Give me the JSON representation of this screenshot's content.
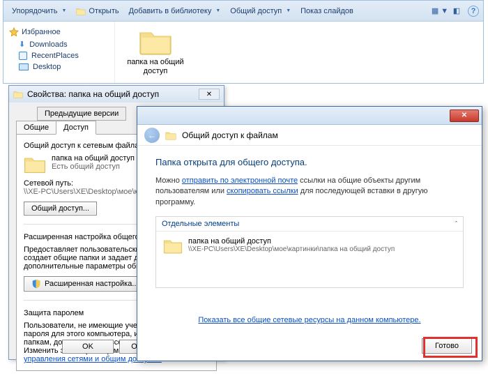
{
  "explorer": {
    "toolbar": {
      "organize": "Упорядочить",
      "open": "Открыть",
      "addlib": "Добавить в библиотеку",
      "share": "Общий доступ",
      "slideshow": "Показ слайдов"
    },
    "favorites": {
      "header": "Избранное",
      "items": [
        "Downloads",
        "RecentPlaces",
        "Desktop"
      ]
    },
    "folder_name": "папка на общий доступ"
  },
  "props": {
    "title": "Свойства: папка на общий доступ",
    "tabs": {
      "prev": "Предыдущие версии",
      "general": "Общие",
      "access": "Доступ"
    },
    "section1_title": "Общий доступ к сетевым файлам и папкам",
    "folder_name": "папка на общий доступ",
    "status": "Есть общий доступ",
    "netpath_label": "Сетевой путь:",
    "netpath": "\\\\XE-PC\\Users\\XE\\Desktop\\мое\\картинки",
    "btn_share": "Общий доступ...",
    "adv_title": "Расширенная настройка общего доступа",
    "adv_text": "Предоставляет пользовательские разрешения, создает общие папки и задает другие дополнительные параметры общего доступа.",
    "btn_adv": "Расширенная настройка...",
    "pwd_title": "Защита паролем",
    "pwd_text": "Пользователи, не имеющие учетной записи и пароля для этого компьютера, имеют доступ к папкам, доступным для всех.",
    "pwd_link_pre": "Изменить этот параметр можно через ",
    "pwd_link": "Центр управления сетями и общим доступом",
    "ok": "OK",
    "cancel": "Отмена"
  },
  "wizard": {
    "header": "Общий доступ к файлам",
    "h1": "Папка открыта для общего доступа.",
    "text_pre": "Можно ",
    "link1": "отправить по электронной почте",
    "text_mid": " ссылки на общие объекты другим пользователям или ",
    "link2": "скопировать ссылки",
    "text_post": " для последующей вставки в другую программу.",
    "group_title": "Отдельные элементы",
    "item_name": "папка на общий доступ",
    "item_path": "\\\\XE-PC\\Users\\XE\\Desktop\\мое\\картинки\\папка на общий доступ",
    "footer_link": "Показать все общие сетевые ресурсы на данном компьютере.",
    "done": "Готово"
  }
}
